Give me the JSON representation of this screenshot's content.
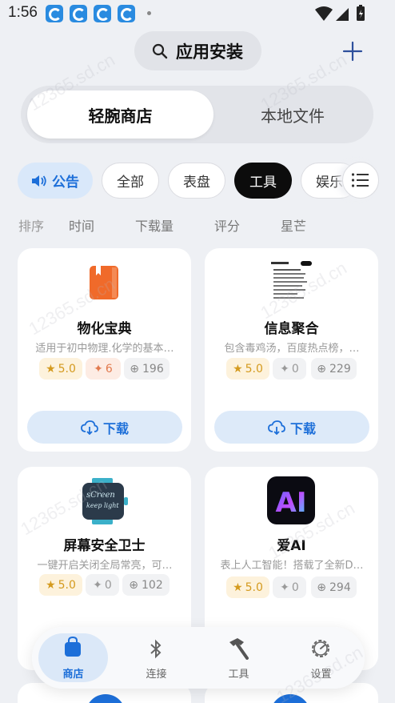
{
  "status_bar": {
    "time": "1:56"
  },
  "header": {
    "title": "应用安装"
  },
  "segments": {
    "active": "轻腕商店",
    "inactive": "本地文件"
  },
  "chips": [
    "全部",
    "表盘",
    "工具",
    "娱乐"
  ],
  "notice_chip": "公告",
  "selected_chip": "工具",
  "sort_options": [
    "排序",
    "时间",
    "下载量",
    "评分",
    "星芒"
  ],
  "apps": [
    {
      "name": "物化宝典",
      "desc": "适用于初中物理.化学的基本…",
      "rating": "5.0",
      "stars": "6",
      "downloads": "196",
      "download_label": "下载"
    },
    {
      "name": "信息聚合",
      "desc": "包含毒鸡汤，百度热点榜，…",
      "rating": "5.0",
      "stars": "0",
      "downloads": "229",
      "download_label": "下载"
    },
    {
      "name": "屏幕安全卫士",
      "desc": "一键开启关闭全局常亮，可…",
      "rating": "5.0",
      "stars": "0",
      "downloads": "102",
      "download_label": "下载"
    },
    {
      "name": "爱AI",
      "desc": "表上人工智能！搭载了全新D…",
      "rating": "5.0",
      "stars": "0",
      "downloads": "294",
      "download_label": "下载"
    }
  ],
  "app_icon_text": {
    "ai_logo": "AI",
    "screen_line1": "sCreen",
    "screen_line2": "keep light"
  },
  "bottom_nav": [
    {
      "label": "商店",
      "icon": "bag-icon"
    },
    {
      "label": "连接",
      "icon": "bluetooth-icon"
    },
    {
      "label": "工具",
      "icon": "hammer-icon"
    },
    {
      "label": "设置",
      "icon": "gear-icon"
    }
  ],
  "watermark": "12365.sd.cn",
  "colors": {
    "accent": "#1d6fd9",
    "rating": "#d49a1e",
    "dark_chip": "#0c0c0c"
  }
}
